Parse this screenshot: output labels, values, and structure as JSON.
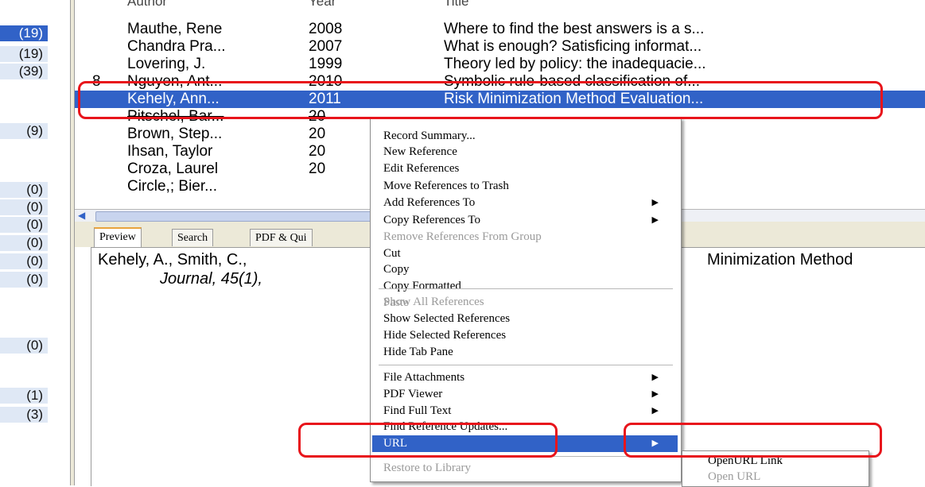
{
  "groups": {
    "counts": [
      "(19)",
      "(19)",
      "(39)",
      "(9)",
      "(0)",
      "(0)",
      "(0)",
      "(0)",
      "(0)",
      "(0)",
      "(0)",
      "(1)",
      "(3)"
    ]
  },
  "ref_list": {
    "headers": {
      "flag": "",
      "author": "Author",
      "year": "Year",
      "title": "Title"
    },
    "rows": [
      {
        "flag": "",
        "author": "Mauthe, Rene",
        "year": "2008",
        "title": "Where to find the best answers is a s..."
      },
      {
        "flag": "",
        "author": "Chandra Pra...",
        "year": "2007",
        "title": "What is enough? Satisficing informat..."
      },
      {
        "flag": "",
        "author": "Lovering, J.",
        "year": "1999",
        "title": "Theory led by policy: the inadequacie..."
      },
      {
        "flag": "8",
        "author": "Nguyen, Ant...",
        "year": "2010",
        "title": "Symbolic rule-based classification of..."
      },
      {
        "flag": "",
        "author": "Kehely, Ann...",
        "year": "2011",
        "title": "Risk Minimization Method Evaluation..."
      },
      {
        "flag": "",
        "author": "Pitschel, Bar...",
        "year": "20",
        "title": ""
      },
      {
        "flag": "",
        "author": "Brown, Step...",
        "year": "20",
        "title": ""
      },
      {
        "flag": "",
        "author": "Ihsan, Taylor",
        "year": "20",
        "title": ""
      },
      {
        "flag": "",
        "author": "Croza, Laurel",
        "year": "20",
        "title": ""
      },
      {
        "flag": "",
        "author": "Circle,; Bier...",
        "year": "",
        "title": ""
      }
    ]
  },
  "preview": {
    "tabs": [
      "Preview",
      "Search",
      "PDF & Qui"
    ],
    "citation": "Kehely, A., Smith, C.,",
    "journal": "Journal, 45(1),",
    "citation_tail": "Minimization Method"
  },
  "context_menu": {
    "items": [
      {
        "label": "Record Summary...",
        "disabled": false,
        "submenu": false
      },
      {
        "label": "New Reference",
        "disabled": false,
        "submenu": false
      },
      {
        "label": "Edit References",
        "disabled": false,
        "submenu": false
      },
      {
        "label": "Move References to Trash",
        "disabled": false,
        "submenu": false
      },
      {
        "label": "Add References To",
        "disabled": false,
        "submenu": true
      },
      {
        "label": "Copy References To",
        "disabled": false,
        "submenu": true
      },
      {
        "label": "Remove References From Group",
        "disabled": true,
        "submenu": false
      },
      {
        "label": "Cut",
        "disabled": false,
        "submenu": false
      },
      {
        "label": "Copy",
        "disabled": false,
        "submenu": false
      },
      {
        "label": "Copy Formatted",
        "disabled": false,
        "submenu": false
      },
      {
        "label": "Paste",
        "disabled": true,
        "submenu": false
      },
      {
        "label": "Show All References",
        "disabled": true,
        "submenu": false
      },
      {
        "label": "Show Selected References",
        "disabled": false,
        "submenu": false
      },
      {
        "label": "Hide Selected References",
        "disabled": false,
        "submenu": false
      },
      {
        "label": "Hide Tab Pane",
        "disabled": false,
        "submenu": false
      },
      {
        "label": "File Attachments",
        "disabled": false,
        "submenu": true
      },
      {
        "label": "PDF Viewer",
        "disabled": false,
        "submenu": true
      },
      {
        "label": "Find Full Text",
        "disabled": false,
        "submenu": true
      },
      {
        "label": "Find Reference Updates...",
        "disabled": false,
        "submenu": false
      },
      {
        "label": "URL",
        "disabled": false,
        "submenu": true,
        "highlighted": true
      },
      {
        "label": "Restore to Library",
        "disabled": true,
        "submenu": false
      }
    ],
    "submenu_arrow": "▶"
  },
  "url_submenu": {
    "items": [
      {
        "label": "OpenURL Link",
        "disabled": false
      },
      {
        "label": "Open URL",
        "disabled": true
      }
    ]
  },
  "colors": {
    "selection": "#3162c7",
    "annotation": "#e8141b",
    "tab_accent": "#e8a33d"
  }
}
